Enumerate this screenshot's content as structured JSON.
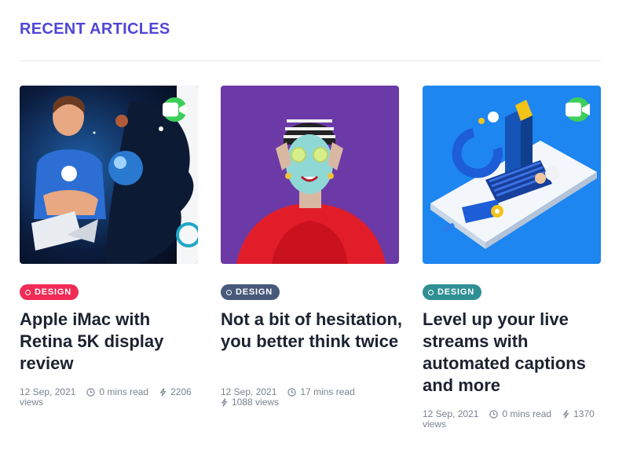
{
  "section": {
    "title": "RECENT ARTICLES"
  },
  "articles": [
    {
      "category": "DESIGN",
      "title": "Apple iMac with Retina 5K display review",
      "date": "12 Sep, 2021",
      "read_time": "0 mins read",
      "views_count": "2206",
      "views_label": "views",
      "has_video": true,
      "tag_color": "#ef2b56"
    },
    {
      "category": "DESIGN",
      "title": "Not a bit of hesitation, you better think twice",
      "date": "12 Sep, 2021",
      "read_time": "17 mins read",
      "views_count": "1088 views",
      "has_video": false,
      "tag_color": "#475a7a"
    },
    {
      "category": "DESIGN",
      "title": "Level up your live streams with automated captions and more",
      "date": "12 Sep, 2021",
      "read_time": "0 mins read",
      "views_count": "1370",
      "views_label": "views",
      "has_video": true,
      "tag_color": "#2f8f93"
    }
  ],
  "colors": {
    "accent": "#5046d6",
    "video_badge": "#3ccf5b"
  },
  "icons": {
    "video": "video-camera-icon",
    "clock": "clock-icon",
    "views": "lightning-icon",
    "tag": "circle-icon"
  }
}
